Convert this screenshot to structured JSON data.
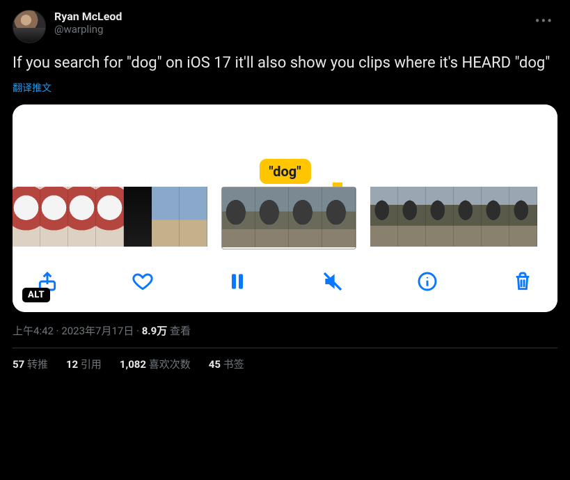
{
  "author": {
    "display_name": "Ryan McLeod",
    "handle": "@warpling"
  },
  "tweet_text": "If you search for \"dog\" on iOS 17 it'll also show you clips where it's HEARD \"dog\"",
  "translate_label": "翻译推文",
  "media": {
    "search_term": "\"dog\"",
    "alt_badge": "ALT",
    "toolbar": {
      "share": "share",
      "like": "like",
      "pause": "pause",
      "mute": "mute",
      "info": "info",
      "trash": "trash"
    }
  },
  "meta": {
    "time": "上午4:42",
    "sep1": " · ",
    "date": "2023年7月17日",
    "sep2": " · ",
    "views_num": "8.9万",
    "views_label": " 查看"
  },
  "stats": {
    "retweets_n": "57",
    "retweets_label": " 转推",
    "quotes_n": "12",
    "quotes_label": " 引用",
    "likes_n": "1,082",
    "likes_label": " 喜欢次数",
    "bookmarks_n": "45",
    "bookmarks_label": " 书签"
  }
}
